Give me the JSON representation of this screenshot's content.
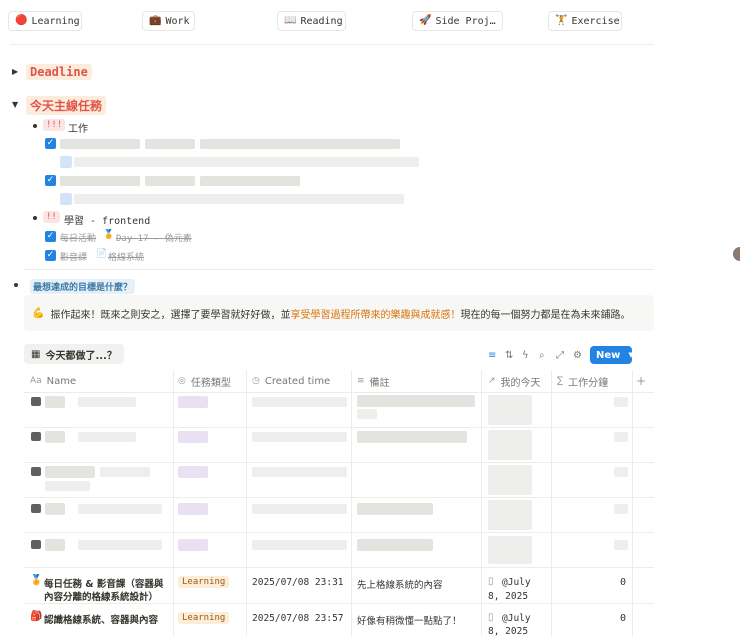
{
  "categories": [
    {
      "icon": "🔴",
      "label": "Learning"
    },
    {
      "icon": "💼",
      "label": "Work"
    },
    {
      "icon": "📖",
      "label": "Reading"
    },
    {
      "icon": "🚀",
      "label": "Side Proj…"
    },
    {
      "icon": "🏋",
      "label": "Exercise"
    }
  ],
  "deadline": {
    "label": "Deadline"
  },
  "today": {
    "label": "今天主線任務",
    "work": {
      "priority": "!!!",
      "label": "工作"
    },
    "study": {
      "priority": "!!",
      "label": "學習 - frontend",
      "tasks": [
        {
          "label": "每日活動",
          "link_icon": "🏅",
          "link_text": "Day 17 - 偽元素"
        },
        {
          "label": "影音課",
          "link_icon": "📄",
          "link_text": "格線系統"
        }
      ]
    }
  },
  "goal": {
    "question": "最想達成的目標是什麼？",
    "icon": "💪",
    "text_before": "振作起來！既來之則安之，選擇了要學習就好好做，並",
    "highlight": "享受學習過程所帶來的樂趣與成就感！",
    "text_after": "現在的每一個努力都是在為未來鋪路。"
  },
  "database": {
    "title": "今天都做了...？",
    "new_label": "New",
    "columns": [
      {
        "icon": "Aa",
        "label": "Name"
      },
      {
        "icon": "◎",
        "label": "任務類型"
      },
      {
        "icon": "◷",
        "label": "Created time"
      },
      {
        "icon": "≡",
        "label": "備註"
      },
      {
        "icon": "↗",
        "label": "我的今天"
      },
      {
        "icon": "∑",
        "label": "工作分鐘"
      }
    ],
    "rows": [
      {
        "icon": "🏅",
        "name_line1": "每日任務 & 影音課（容器與",
        "name_line2": "內容分離的格線系統設計）",
        "type": "Learning",
        "created": "2025/07/08 23:31",
        "note": "先上格線系統的內容",
        "today_line1": "@July",
        "today_line2": "8, 2025",
        "minutes": "0"
      },
      {
        "icon": "🎒",
        "name_line1": "認識格線系統、容器與內容",
        "name_line2": "",
        "type": "Learning",
        "created": "2025/07/08 23:57",
        "note": "好像有稍微懂一點點了！",
        "today_line1": "@July",
        "today_line2": "8, 2025",
        "minutes": "0"
      }
    ]
  }
}
